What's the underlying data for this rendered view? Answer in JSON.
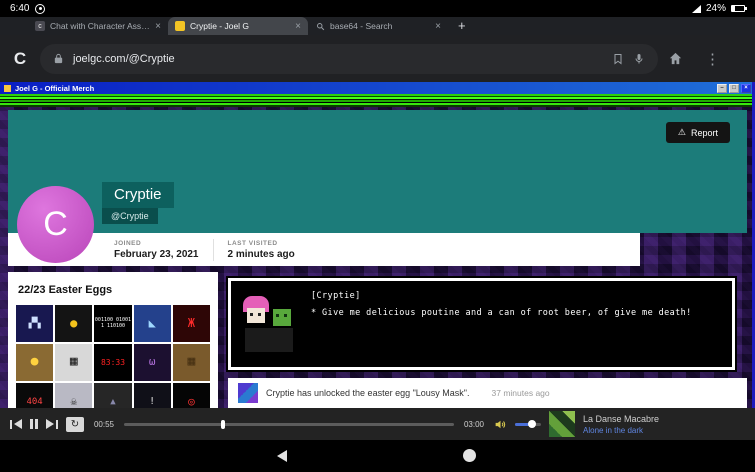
{
  "status_bar": {
    "time": "6:40",
    "battery": "24%"
  },
  "tab_strip": {
    "close_icon": "×",
    "new_tab_icon": "+",
    "tabs": [
      {
        "label": "Chat with Character Assista",
        "icon_letter": "c"
      },
      {
        "label": "Cryptie - Joel G"
      },
      {
        "label": "base64 - Search"
      }
    ]
  },
  "toolbar": {
    "browser_logo": "C",
    "url": "joelgc.com/@Cryptie",
    "menu_icon": "⋮"
  },
  "win": {
    "title": "Joel G - Official Merch",
    "minimize_icon": "–",
    "maximize_icon": "□",
    "close_icon": "×"
  },
  "profile": {
    "report_label": "Report",
    "warning_icon": "⚠",
    "avatar_letter": "C",
    "name": "Cryptie",
    "handle": "@Cryptie",
    "joined_label": "JOINED",
    "joined_value": "February 23, 2021",
    "visited_label": "LAST VISITED",
    "visited_value": "2 minutes ago",
    "banner_color": "#1c7c7a",
    "avatar_color": "#cb57cb"
  },
  "easter_eggs": {
    "title": "22/23 Easter Eggs",
    "tiles": [
      {
        "bg": "#181850",
        "fg": "#cfe0ff",
        "text": "▞▚",
        "fs": 10
      },
      {
        "bg": "#141414",
        "fg": "#f2c21c",
        "text": "●",
        "fs": 12
      },
      {
        "bg": "#000000",
        "fg": "#ffffff",
        "text": "001100 010011 110100",
        "fs": 5
      },
      {
        "bg": "#24418c",
        "fg": "#9fd8ff",
        "text": "◣",
        "fs": 12
      },
      {
        "bg": "#2e0606",
        "fg": "#ff2b2b",
        "text": "Ж",
        "fs": 12
      },
      {
        "bg": "#8a6a33",
        "fg": "#ffd23f",
        "text": "●",
        "fs": 13
      },
      {
        "bg": "#d8d8d8",
        "fg": "#222222",
        "text": "▦",
        "fs": 13
      },
      {
        "bg": "#000000",
        "fg": "#ff2222",
        "text": "83:33",
        "fs": 8
      },
      {
        "bg": "#1c1030",
        "fg": "#b06fd9",
        "text": "ω",
        "fs": 11
      },
      {
        "bg": "#7a5a2c",
        "fg": "#463012",
        "text": "▦",
        "fs": 13
      },
      {
        "bg": "#0a0a0a",
        "fg": "#ff4444",
        "text": "404",
        "fs": 9
      },
      {
        "bg": "#b9b9c4",
        "fg": "#333333",
        "text": "☠",
        "fs": 11
      },
      {
        "bg": "#262626",
        "fg": "#8888aa",
        "text": "▲",
        "fs": 9
      },
      {
        "bg": "#101018",
        "fg": "#dddddd",
        "text": "!",
        "fs": 10
      },
      {
        "bg": "#050505",
        "fg": "#ff3333",
        "text": "◎",
        "fs": 11
      }
    ]
  },
  "dialog": {
    "speaker": "[Cryptie]",
    "line": "* Give me delicious poutine and a can of root beer, of give me death!"
  },
  "feed": {
    "text": "Cryptie has unlocked the easter egg \"Lousy Mask\".",
    "time": "37 minutes ago"
  },
  "player": {
    "elapsed": "00:55",
    "duration": "03:00",
    "loop_icon": "↻",
    "progress_pct": 30,
    "volume_pct": 65,
    "track_title": "La Danse Macabre",
    "track_subtitle": "Alone in the dark"
  }
}
